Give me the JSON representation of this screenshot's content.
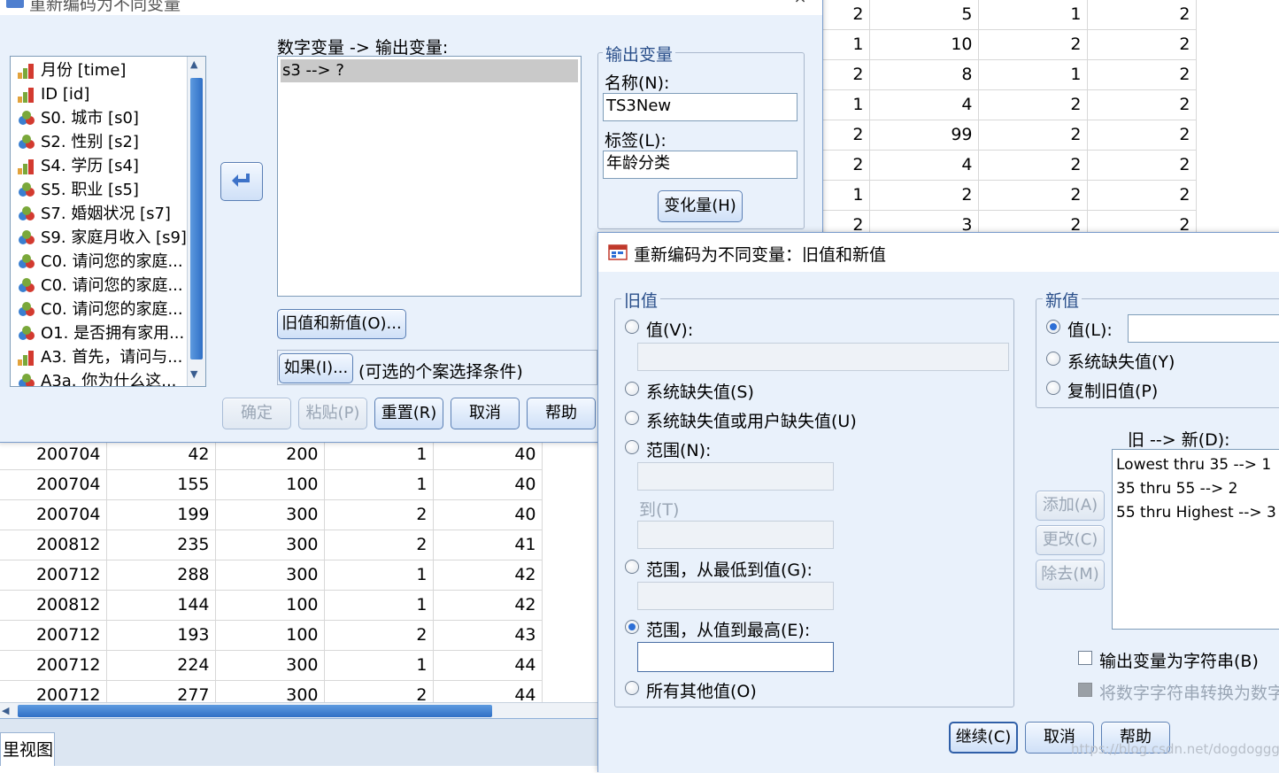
{
  "grid_top_right": {
    "rows": [
      [
        "2",
        "5",
        "1",
        "2"
      ],
      [
        "1",
        "10",
        "2",
        "2"
      ],
      [
        "2",
        "8",
        "1",
        "2"
      ],
      [
        "1",
        "4",
        "2",
        "2"
      ],
      [
        "2",
        "99",
        "2",
        "2"
      ],
      [
        "2",
        "4",
        "2",
        "2"
      ],
      [
        "1",
        "2",
        "2",
        "2"
      ],
      [
        "2",
        "3",
        "2",
        "2"
      ]
    ]
  },
  "grid_bottom_left": {
    "rows": [
      [
        "200704",
        "42",
        "200",
        "1",
        "40"
      ],
      [
        "200704",
        "155",
        "100",
        "1",
        "40"
      ],
      [
        "200704",
        "199",
        "300",
        "2",
        "40"
      ],
      [
        "200812",
        "235",
        "300",
        "2",
        "41"
      ],
      [
        "200712",
        "288",
        "300",
        "1",
        "42"
      ],
      [
        "200812",
        "144",
        "100",
        "1",
        "42"
      ],
      [
        "200712",
        "193",
        "100",
        "2",
        "43"
      ],
      [
        "200712",
        "224",
        "300",
        "1",
        "44"
      ],
      [
        "200712",
        "277",
        "300",
        "2",
        "44"
      ]
    ]
  },
  "status_tab": "里视图",
  "main_dialog": {
    "title": "重新编码为不同变量",
    "variables": [
      {
        "label": "月份 [time]",
        "icon": "scale-icon"
      },
      {
        "label": "ID [id]",
        "icon": "scale-icon"
      },
      {
        "label": "S0. 城市 [s0]",
        "icon": "nominal-icon"
      },
      {
        "label": "S2. 性别 [s2]",
        "icon": "nominal-icon"
      },
      {
        "label": "S4. 学历 [s4]",
        "icon": "scale-icon"
      },
      {
        "label": "S5. 职业 [s5]",
        "icon": "nominal-icon"
      },
      {
        "label": "S7. 婚姻状况 [s7]",
        "icon": "nominal-icon"
      },
      {
        "label": "S9. 家庭月收入 [s9]",
        "icon": "nominal-icon"
      },
      {
        "label": "C0. 请问您的家庭...",
        "icon": "nominal-icon"
      },
      {
        "label": "C0. 请问您的家庭...",
        "icon": "nominal-icon"
      },
      {
        "label": "C0. 请问您的家庭...",
        "icon": "nominal-icon"
      },
      {
        "label": "O1. 是否拥有家用...",
        "icon": "nominal-icon"
      },
      {
        "label": "A3. 首先，请问与...",
        "icon": "scale-icon"
      },
      {
        "label": "A3a. 你为什么这...",
        "icon": "nominal-icon"
      }
    ],
    "mapping_label": "数字变量 -> 输出变量:",
    "mapping_item": "s3 --> ?",
    "output_group_title": "输出变量",
    "name_label": "名称(N):",
    "name_value": "TS3New",
    "label_label": "标签(L):",
    "label_value": "年龄分类",
    "change_button": "变化量(H)",
    "old_new_button": "旧值和新值(O)...",
    "if_button": "如果(I)...",
    "if_hint": "(可选的个案选择条件)",
    "ok_button": "确定",
    "paste_button": "粘贴(P)",
    "reset_button": "重置(R)",
    "cancel_button": "取消",
    "help_button": "帮助"
  },
  "sub_dialog": {
    "title": "重新编码为不同变量：旧值和新值",
    "old_group_title": "旧值",
    "old_value_label": "值(V):",
    "old_sysmis_label": "系统缺失值(S)",
    "old_sysuser_label": "系统缺失值或用户缺失值(U)",
    "old_range_label": "范围(N):",
    "old_to_label": "到(T)",
    "old_lowest_label": "范围，从最低到值(G):",
    "old_highest_label": "范围，从值到最高(E):",
    "old_else_label": "所有其他值(O)",
    "new_group_title": "新值",
    "new_value_label": "值(L):",
    "new_sysmis_label": "系统缺失值(Y)",
    "new_copy_label": "复制旧值(P)",
    "rules_label": "旧 --> 新(D):",
    "rules": [
      "Lowest thru 35 --> 1",
      "35 thru 55 --> 2",
      "55 thru Highest --> 3"
    ],
    "add_button": "添加(A)",
    "change_button": "更改(C)",
    "remove_button": "除去(M)",
    "string_output_label": "输出变量为字符串(B)",
    "convert_label": "将数字字符串转换为数字",
    "continue_button": "继续(C)",
    "cancel_button": "取消",
    "help_button": "帮助",
    "watermark": "https://blog.csdn.net/dogdogggg"
  }
}
